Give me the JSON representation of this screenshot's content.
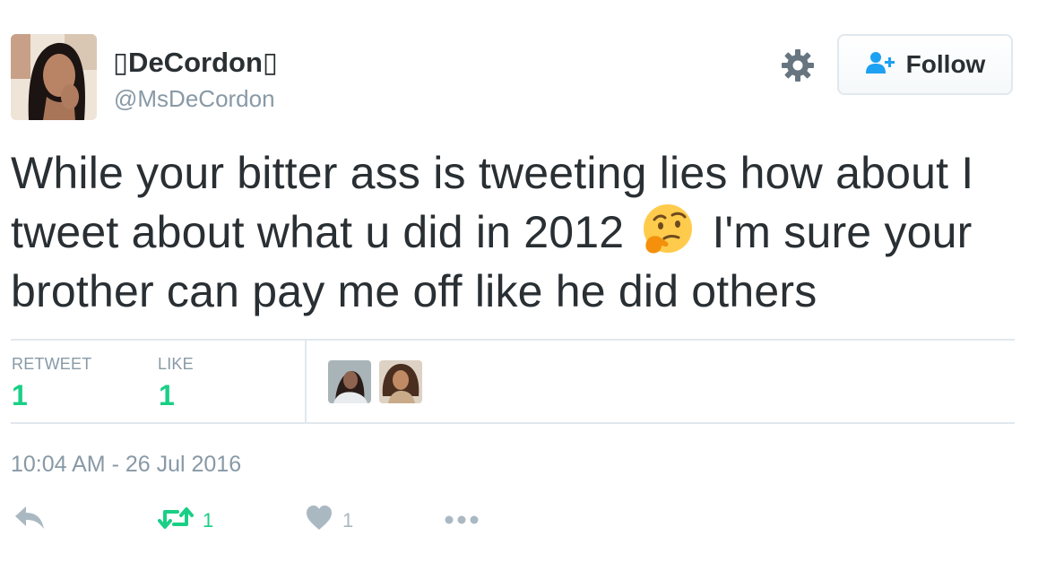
{
  "user": {
    "display_name": "▯DeCordon▯",
    "handle": "@MsDeCordon"
  },
  "header": {
    "follow_label": "Follow"
  },
  "tweet": {
    "text_before_emoji": "While your bitter ass is tweeting lies how about I tweet about what u did in 2012",
    "emoji": "thinking-face-emoji",
    "text_after_emoji": "I'm sure your brother can pay me off like he did others",
    "timestamp": "10:04 AM - 26 Jul 2016"
  },
  "stats": {
    "retweet_label": "RETWEET",
    "retweet_count": "1",
    "like_label": "LIKE",
    "like_count": "1"
  },
  "actions": {
    "retweet_count": "1",
    "like_count": "1"
  },
  "colors": {
    "text": "#292f33",
    "muted": "#8899a6",
    "retweet_green": "#19cf86",
    "divider": "#e1e8ed",
    "follow_icon": "#1da1f2"
  }
}
